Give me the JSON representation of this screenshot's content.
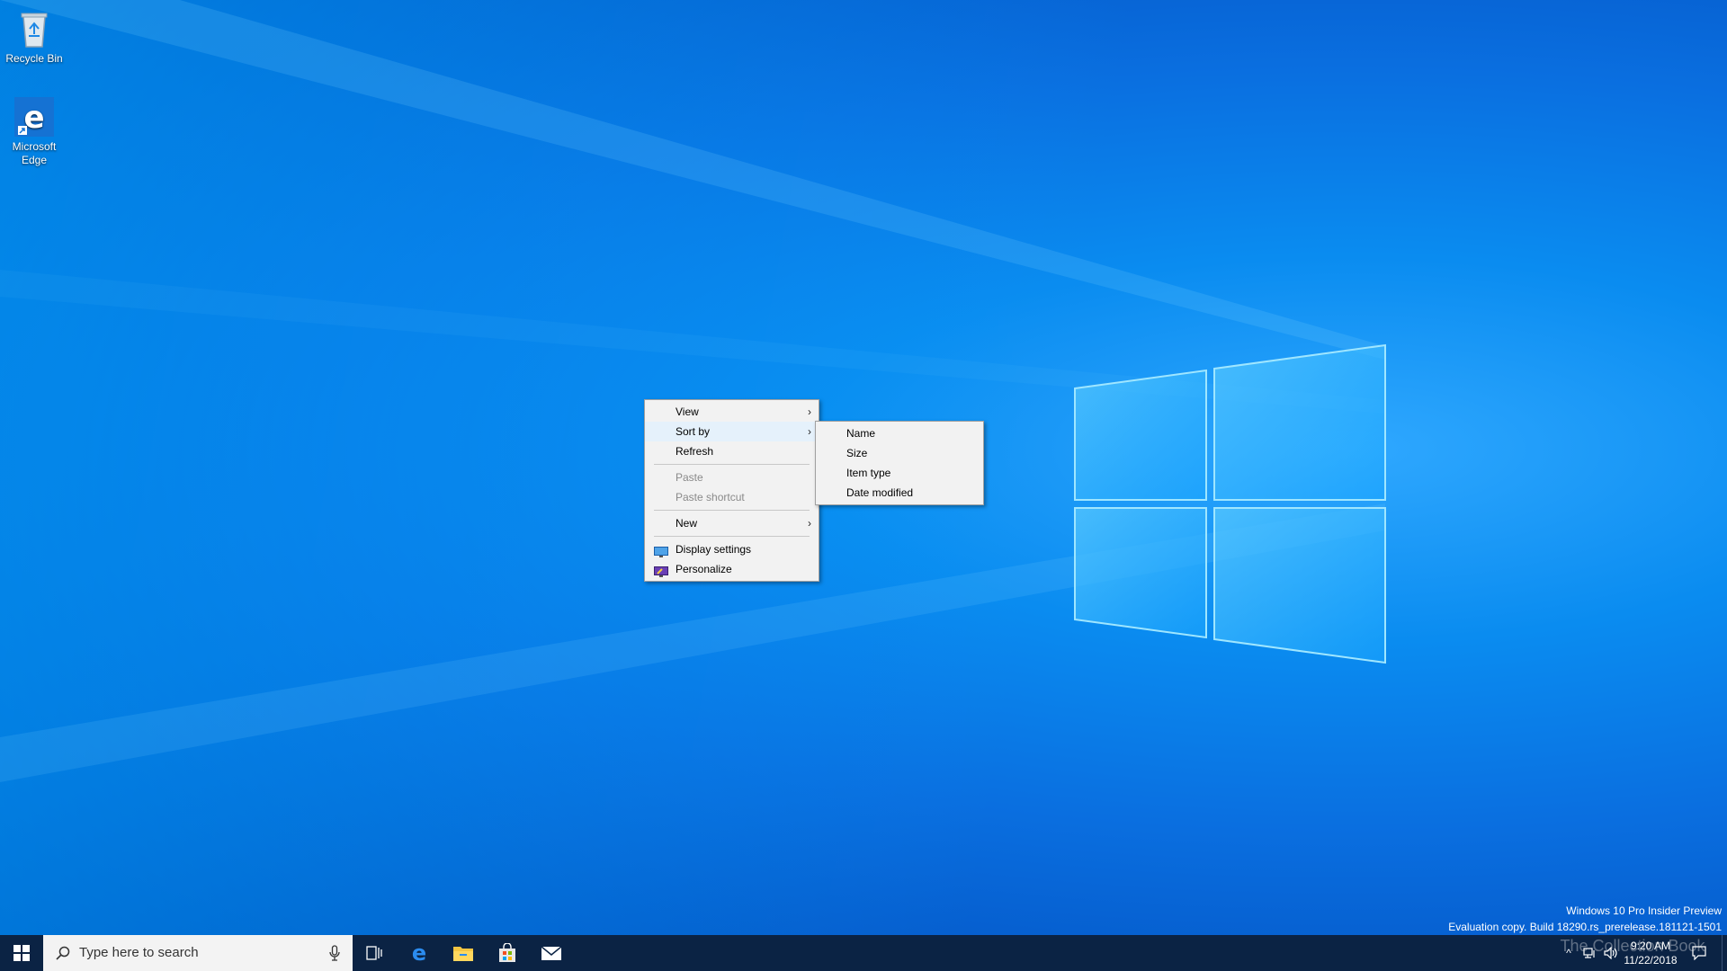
{
  "desktop": {
    "icons": [
      {
        "label": "Recycle Bin",
        "icon": "recycle-bin-icon"
      },
      {
        "label_line1": "Microsoft",
        "label_line2": "Edge",
        "icon": "edge-icon"
      }
    ],
    "watermark_line1": "Windows 10 Pro Insider Preview",
    "watermark_line2": "Evaluation copy. Build 18290.rs_prerelease.181121-1501",
    "overlay_text": "The Collection Book"
  },
  "context_menu": {
    "items": [
      {
        "label": "View",
        "submenu": true
      },
      {
        "label": "Sort by",
        "submenu": true,
        "active": true
      },
      {
        "label": "Refresh"
      },
      {
        "label": "Paste",
        "disabled": true
      },
      {
        "label": "Paste shortcut",
        "disabled": true
      },
      {
        "label": "New",
        "submenu": true
      },
      {
        "label": "Display settings",
        "icon": "display-icon"
      },
      {
        "label": "Personalize",
        "icon": "personalize-icon"
      }
    ]
  },
  "sort_submenu": {
    "items": [
      "Name",
      "Size",
      "Item type",
      "Date modified"
    ]
  },
  "taskbar": {
    "search_placeholder": "Type here to search",
    "time": "9:20 AM",
    "date": "11/22/2018",
    "pinned": [
      "task-view-icon",
      "edge-icon",
      "file-explorer-icon",
      "store-icon",
      "mail-icon"
    ]
  },
  "colors": {
    "accent": "#0078d7",
    "taskbar": "#0b2344",
    "menu_bg": "#f2f2f2",
    "menu_hover": "#e5f1fb"
  }
}
